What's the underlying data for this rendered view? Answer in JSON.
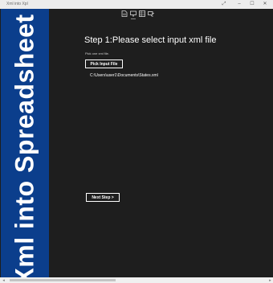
{
  "window": {
    "title": "Xml into Xpl",
    "fullscreen_icon": "⤢",
    "minimize_icon": "–",
    "maximize_icon": "☐",
    "close_icon": "✕"
  },
  "sidebar": {
    "title": "Xml into Spreadsheet",
    "background": "#0b3e8c"
  },
  "steps": [
    {
      "icon": "xml-file-icon"
    },
    {
      "icon": "monitor-icon"
    },
    {
      "icon": "spreadsheet-icon"
    },
    {
      "icon": "export-icon"
    }
  ],
  "main": {
    "heading": "Step 1:Please select input xml file",
    "hint": "Pick one xml file.",
    "pick_button": "Pick Input File",
    "file_path": "C:\\Users\\user1\\Documents\\States.xml",
    "next_button": "Next Step >"
  }
}
